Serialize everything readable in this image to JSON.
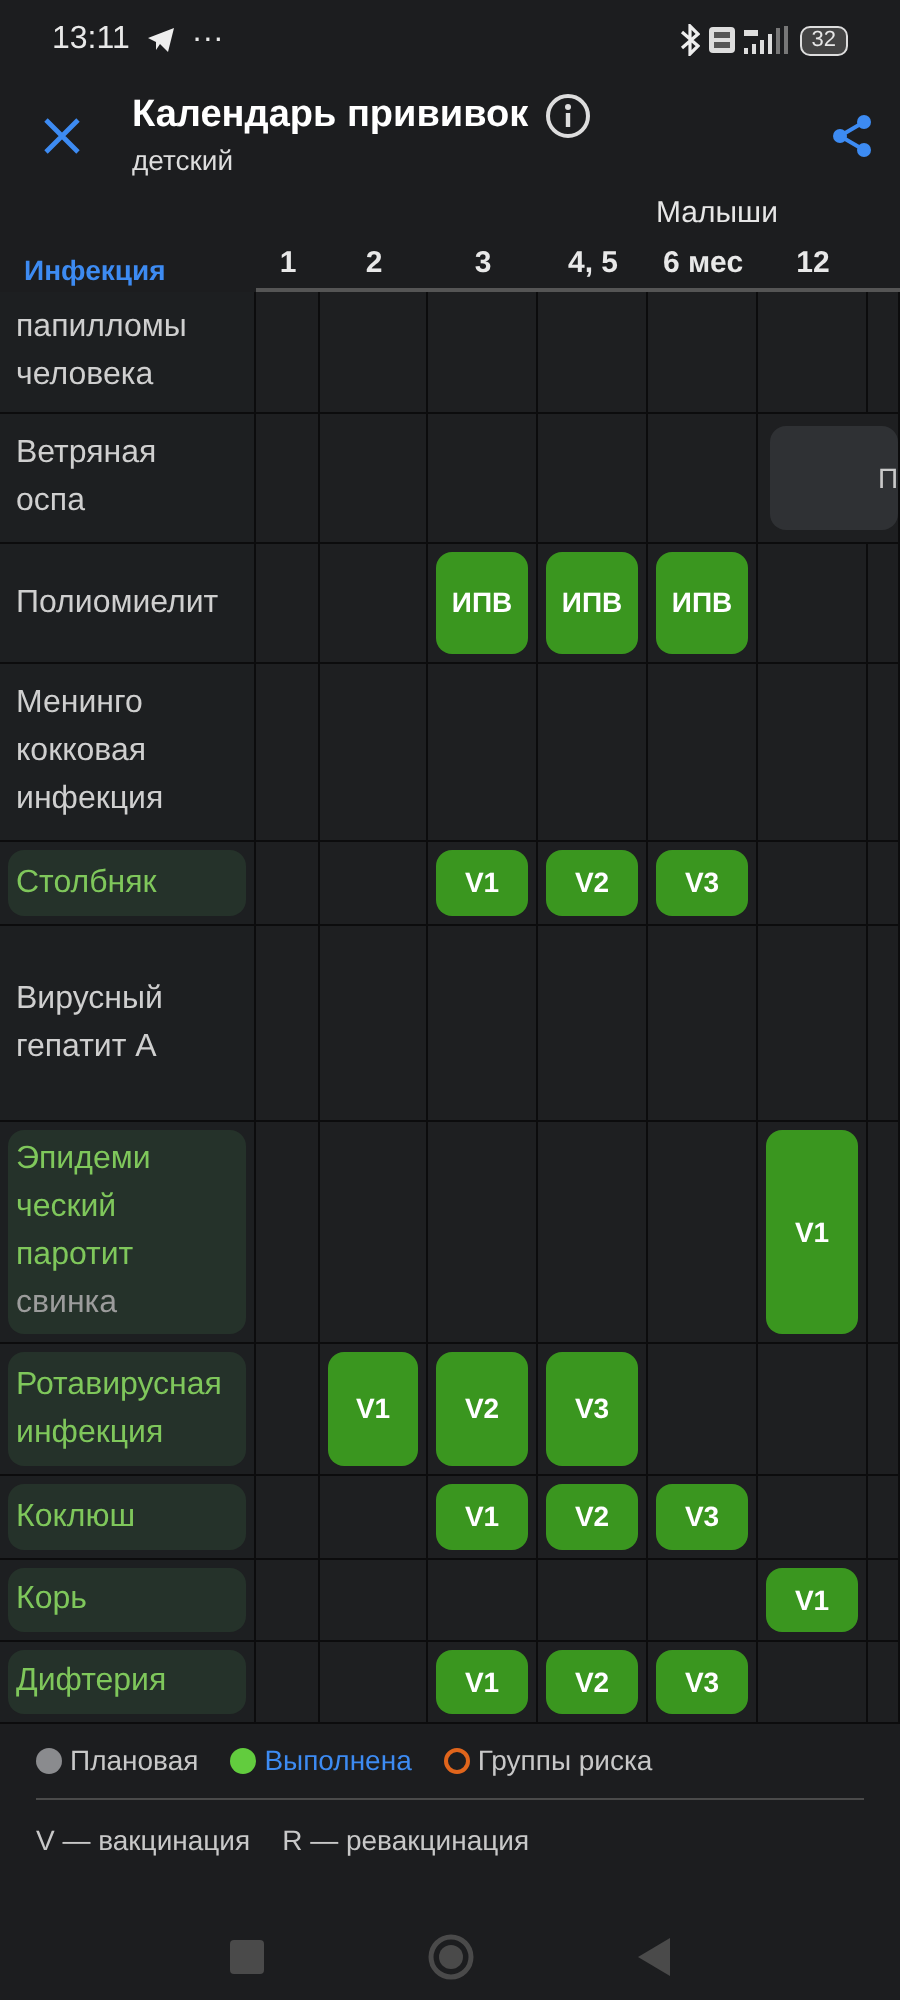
{
  "status_bar": {
    "time": "13:11",
    "more": "···",
    "battery": "32"
  },
  "app_bar": {
    "title": "Календарь прививок",
    "subtitle": "детский"
  },
  "table": {
    "header_label": "Инфекция",
    "group_label": "Малыши",
    "columns": [
      "1",
      "2",
      "3",
      "4, 5",
      "6 мес",
      "12"
    ],
    "rows": [
      {
        "name": "папилломы\nчеловека",
        "done": false,
        "cells": [
          null,
          null,
          null,
          null,
          null,
          null,
          null
        ]
      },
      {
        "name": "Ветряная\nоспа",
        "done": false,
        "cells": [
          null,
          null,
          null,
          null,
          null,
          {
            "label": "П",
            "done": false,
            "kind": "wide"
          }
        ]
      },
      {
        "name": "Полиомиелит",
        "done": false,
        "cells": [
          null,
          null,
          {
            "label": "ИПВ",
            "done": true,
            "kind": "single"
          },
          {
            "label": "ИПВ",
            "done": true,
            "kind": "single"
          },
          {
            "label": "ИПВ",
            "done": true,
            "kind": "single"
          },
          null,
          null
        ]
      },
      {
        "name": "Менинго\nкокковая\nинфекция",
        "done": false,
        "cells": [
          null,
          null,
          null,
          null,
          null,
          null,
          null
        ]
      },
      {
        "name": "Столбняк",
        "done": true,
        "cells": [
          null,
          null,
          {
            "label": "V1",
            "done": true,
            "kind": "single"
          },
          {
            "label": "V2",
            "done": true,
            "kind": "single"
          },
          {
            "label": "V3",
            "done": true,
            "kind": "single"
          },
          null,
          null
        ]
      },
      {
        "name": "Вирусный\nгепатит А",
        "done": false,
        "cells": [
          null,
          null,
          null,
          null,
          null,
          null,
          null
        ]
      },
      {
        "name": "Эпидеми\nческий\nпаротит",
        "note": "свинка",
        "done": true,
        "cells": [
          null,
          null,
          null,
          null,
          null,
          {
            "label": "V1",
            "done": true,
            "kind": "single"
          },
          null
        ]
      },
      {
        "name": "Ротавирусная\nинфекция",
        "done": true,
        "cells": [
          null,
          {
            "label": "V1",
            "done": true,
            "kind": "single"
          },
          {
            "label": "V2",
            "done": true,
            "kind": "single"
          },
          {
            "label": "V3",
            "done": true,
            "kind": "single"
          },
          null,
          null,
          null
        ]
      },
      {
        "name": "Коклюш",
        "done": true,
        "cells": [
          null,
          null,
          {
            "label": "V1",
            "done": true,
            "kind": "single"
          },
          {
            "label": "V2",
            "done": true,
            "kind": "single"
          },
          {
            "label": "V3",
            "done": true,
            "kind": "single"
          },
          null,
          null
        ]
      },
      {
        "name": "Корь",
        "done": true,
        "cells": [
          null,
          null,
          null,
          null,
          null,
          {
            "label": "V1",
            "done": true,
            "kind": "single"
          },
          null
        ]
      },
      {
        "name": "Дифтерия",
        "done": true,
        "cells": [
          null,
          null,
          {
            "label": "V1",
            "done": true,
            "kind": "single"
          },
          {
            "label": "V2",
            "done": true,
            "kind": "single"
          },
          {
            "label": "V3",
            "done": true,
            "kind": "single"
          },
          null,
          null
        ]
      }
    ]
  },
  "legend": [
    {
      "label": "Плановая",
      "kind": "filled",
      "color": "#8a8b8e",
      "selected": false
    },
    {
      "label": "Выполнена",
      "kind": "filled",
      "color": "#62cc3e",
      "selected": true
    },
    {
      "label": "Группы риска",
      "kind": "ring",
      "color": "#e0651c",
      "selected": false
    }
  ],
  "abbreviations": [
    "V — вакцинация",
    "R — ревакцинация"
  ]
}
